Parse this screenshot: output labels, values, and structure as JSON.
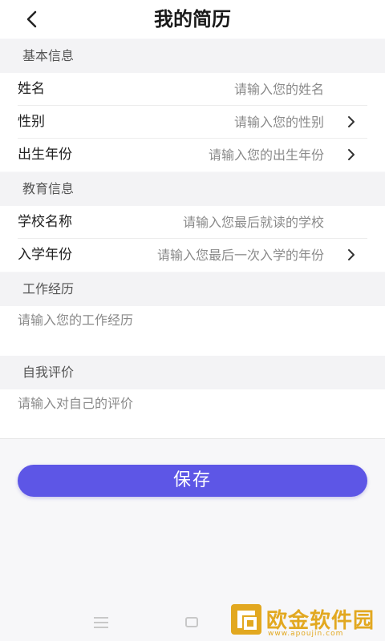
{
  "header": {
    "title": "我的简历"
  },
  "sections": {
    "basic": {
      "title": "基本信息",
      "rows": [
        {
          "label": "姓名",
          "placeholder": "请输入您的姓名",
          "chevron": false
        },
        {
          "label": "性别",
          "placeholder": "请输入您的性别",
          "chevron": true
        },
        {
          "label": "出生年份",
          "placeholder": "请输入您的出生年份",
          "chevron": true
        }
      ]
    },
    "education": {
      "title": "教育信息",
      "rows": [
        {
          "label": "学校名称",
          "placeholder": "请输入您最后就读的学校",
          "chevron": false
        },
        {
          "label": "入学年份",
          "placeholder": "请输入您最后一次入学的年份",
          "chevron": true
        }
      ]
    },
    "work": {
      "title": "工作经历",
      "placeholder": "请输入您的工作经历"
    },
    "self_eval": {
      "title": "自我评价",
      "placeholder": "请输入对自己的评价"
    }
  },
  "actions": {
    "save_label": "保存"
  },
  "watermark": {
    "text": "欧金软件园",
    "url": "www.apoujin.com"
  },
  "colors": {
    "accent": "#5d56e6",
    "watermark": "#e2a820"
  }
}
